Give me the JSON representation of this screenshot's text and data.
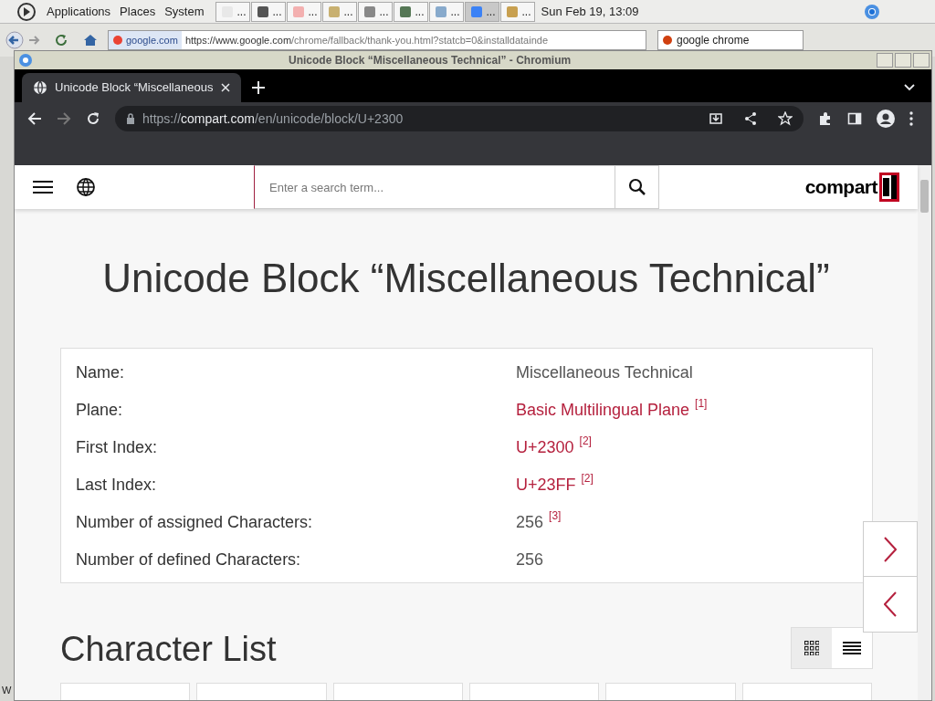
{
  "panel": {
    "menus": [
      "Applications",
      "Places",
      "System"
    ],
    "tasks": [
      {
        "label": "...",
        "selected": false
      },
      {
        "label": "...",
        "selected": false
      },
      {
        "label": "...",
        "selected": false
      },
      {
        "label": "...",
        "selected": false
      },
      {
        "label": "...",
        "selected": false
      },
      {
        "label": "...",
        "selected": false
      },
      {
        "label": "...",
        "selected": false
      },
      {
        "label": "...",
        "selected": true
      },
      {
        "label": "...",
        "selected": false
      }
    ],
    "clock": "Sun Feb 19, 13:09"
  },
  "background_browser": {
    "site_identity": "google.com",
    "url_host": "https://www.google.com",
    "url_rest": "/chrome/fallback/thank-you.html?statcb=0&installdatainde",
    "search": "google chrome"
  },
  "left_edge_text": "W",
  "window": {
    "title": "Unicode Block “Miscellaneous Technical” - Chromium"
  },
  "tabs": [
    {
      "label": "Unicode Block “Miscellaneous",
      "selected": true
    }
  ],
  "address_bar": {
    "scheme": "https://",
    "domain": "compart.com",
    "path": "/en/unicode/block/U+2300"
  },
  "page": {
    "search": {
      "placeholder": "Enter a search term..."
    },
    "logo": "compart",
    "heading": "Unicode Block “Miscellaneous Technical”",
    "info_rows": [
      {
        "label": "Name:",
        "value": "Miscellaneous Technical",
        "link": false
      },
      {
        "label": "Plane:",
        "value": "Basic Multilingual Plane",
        "link": true,
        "note": "[1]"
      },
      {
        "label": "First Index:",
        "value": "U+2300",
        "link": true,
        "note": "[2]"
      },
      {
        "label": "Last Index:",
        "value": "U+23FF",
        "link": true,
        "note": "[2]"
      },
      {
        "label": "Number of assigned Characters:",
        "value": "256",
        "link": false,
        "note": "[3]"
      },
      {
        "label": "Number of defined Characters:",
        "value": "256",
        "link": false
      }
    ],
    "section_title": "Character List",
    "views": [
      {
        "kind": "grid",
        "selected": true
      },
      {
        "kind": "list",
        "selected": false
      }
    ]
  }
}
